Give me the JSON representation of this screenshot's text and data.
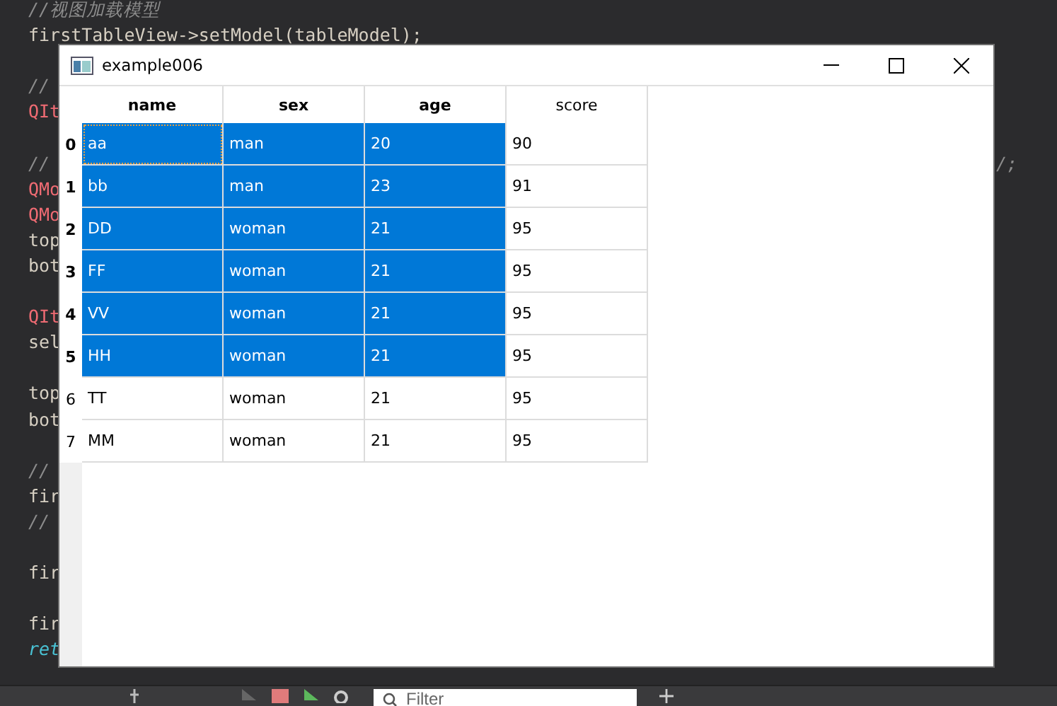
{
  "editor": {
    "lines": [
      {
        "kind": "comment",
        "text": "//视图加载模型"
      },
      {
        "kind": "code",
        "text": "firstTableView->setModel(tableModel);"
      },
      {
        "kind": "blank"
      },
      {
        "kind": "comment",
        "text": "//"
      },
      {
        "kind": "type",
        "text": "QIt"
      },
      {
        "kind": "blank"
      },
      {
        "kind": "comment",
        "text": "//",
        "tail": "/;"
      },
      {
        "kind": "type",
        "text": "QMo"
      },
      {
        "kind": "type",
        "text": "QMo"
      },
      {
        "kind": "code",
        "text": "top"
      },
      {
        "kind": "code",
        "text": "bot"
      },
      {
        "kind": "blank"
      },
      {
        "kind": "type",
        "text": "QIt"
      },
      {
        "kind": "code",
        "text": "sel"
      },
      {
        "kind": "blank"
      },
      {
        "kind": "code",
        "text": "top"
      },
      {
        "kind": "code",
        "text": "bot"
      },
      {
        "kind": "blank"
      },
      {
        "kind": "comment",
        "text": "//"
      },
      {
        "kind": "code",
        "text": "fir"
      },
      {
        "kind": "comment",
        "text": "//"
      },
      {
        "kind": "blank"
      },
      {
        "kind": "code",
        "text": "fir"
      },
      {
        "kind": "blank"
      },
      {
        "kind": "code",
        "text": "fir"
      },
      {
        "kind": "keyword",
        "text": "ret"
      }
    ]
  },
  "window": {
    "title": "example006"
  },
  "table": {
    "columns": [
      {
        "label": "name",
        "selected": true
      },
      {
        "label": "sex",
        "selected": true
      },
      {
        "label": "age",
        "selected": true
      },
      {
        "label": "score",
        "selected": false
      }
    ],
    "rows": [
      {
        "header": "0",
        "selected": true,
        "cells": [
          {
            "text": "aa",
            "selected": true,
            "focused": true
          },
          {
            "text": "man",
            "selected": true,
            "focused": false
          },
          {
            "text": "20",
            "selected": true,
            "focused": false
          },
          {
            "text": "90",
            "selected": false,
            "focused": false
          }
        ]
      },
      {
        "header": "1",
        "selected": true,
        "cells": [
          {
            "text": "bb",
            "selected": true,
            "focused": false
          },
          {
            "text": "man",
            "selected": true,
            "focused": false
          },
          {
            "text": "23",
            "selected": true,
            "focused": false
          },
          {
            "text": "91",
            "selected": false,
            "focused": false
          }
        ]
      },
      {
        "header": "2",
        "selected": true,
        "cells": [
          {
            "text": "DD",
            "selected": true,
            "focused": false
          },
          {
            "text": "woman",
            "selected": true,
            "focused": false
          },
          {
            "text": "21",
            "selected": true,
            "focused": false
          },
          {
            "text": "95",
            "selected": false,
            "focused": false
          }
        ]
      },
      {
        "header": "3",
        "selected": true,
        "cells": [
          {
            "text": "FF",
            "selected": true,
            "focused": false
          },
          {
            "text": "woman",
            "selected": true,
            "focused": false
          },
          {
            "text": "21",
            "selected": true,
            "focused": false
          },
          {
            "text": "95",
            "selected": false,
            "focused": false
          }
        ]
      },
      {
        "header": "4",
        "selected": true,
        "cells": [
          {
            "text": "VV",
            "selected": true,
            "focused": false
          },
          {
            "text": "woman",
            "selected": true,
            "focused": false
          },
          {
            "text": "21",
            "selected": true,
            "focused": false
          },
          {
            "text": "95",
            "selected": false,
            "focused": false
          }
        ]
      },
      {
        "header": "5",
        "selected": true,
        "cells": [
          {
            "text": "HH",
            "selected": true,
            "focused": false
          },
          {
            "text": "woman",
            "selected": true,
            "focused": false
          },
          {
            "text": "21",
            "selected": true,
            "focused": false
          },
          {
            "text": "95",
            "selected": false,
            "focused": false
          }
        ]
      },
      {
        "header": "6",
        "selected": false,
        "cells": [
          {
            "text": "TT",
            "selected": false,
            "focused": false
          },
          {
            "text": "woman",
            "selected": false,
            "focused": false
          },
          {
            "text": "21",
            "selected": false,
            "focused": false
          },
          {
            "text": "95",
            "selected": false,
            "focused": false
          }
        ]
      },
      {
        "header": "7",
        "selected": false,
        "cells": [
          {
            "text": "MM",
            "selected": false,
            "focused": false
          },
          {
            "text": "woman",
            "selected": false,
            "focused": false
          },
          {
            "text": "21",
            "selected": false,
            "focused": false
          },
          {
            "text": "95",
            "selected": false,
            "focused": false
          }
        ]
      }
    ]
  },
  "toolbar": {
    "filter": {
      "placeholder": "Filter"
    }
  }
}
